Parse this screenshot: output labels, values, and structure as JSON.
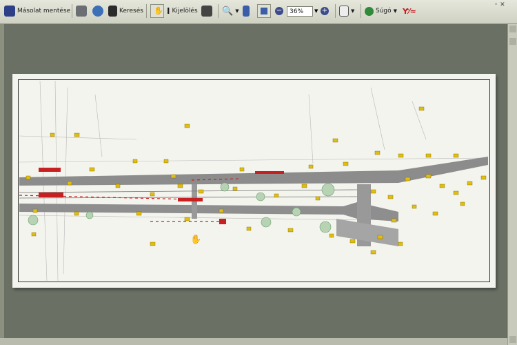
{
  "toolbar": {
    "save_label": "Másolat mentése",
    "search_label": "Keresés",
    "select_label": "Kijelölés",
    "zoom_value": "36%",
    "help_label": "Súgó"
  }
}
